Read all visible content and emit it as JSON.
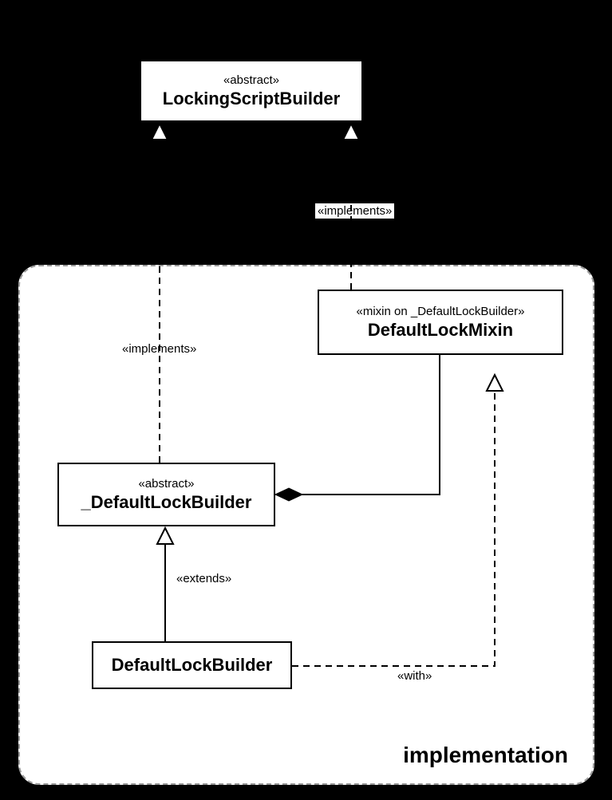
{
  "classes": {
    "lockingScriptBuilder": {
      "stereotype": "«abstract»",
      "name": "LockingScriptBuilder"
    },
    "defaultLockMixin": {
      "stereotype": "«mixin on _DefaultLockBuilder»",
      "name": "DefaultLockMixin"
    },
    "defaultLockBuilderAbstract": {
      "stereotype": "«abstract»",
      "name": "_DefaultLockBuilder"
    },
    "defaultLockBuilder": {
      "name": "DefaultLockBuilder"
    }
  },
  "labels": {
    "implementsTop": "«implements»",
    "implementsLeft": "«implements»",
    "extends": "«extends»",
    "with": "«with»"
  },
  "package": {
    "name": "implementation"
  }
}
